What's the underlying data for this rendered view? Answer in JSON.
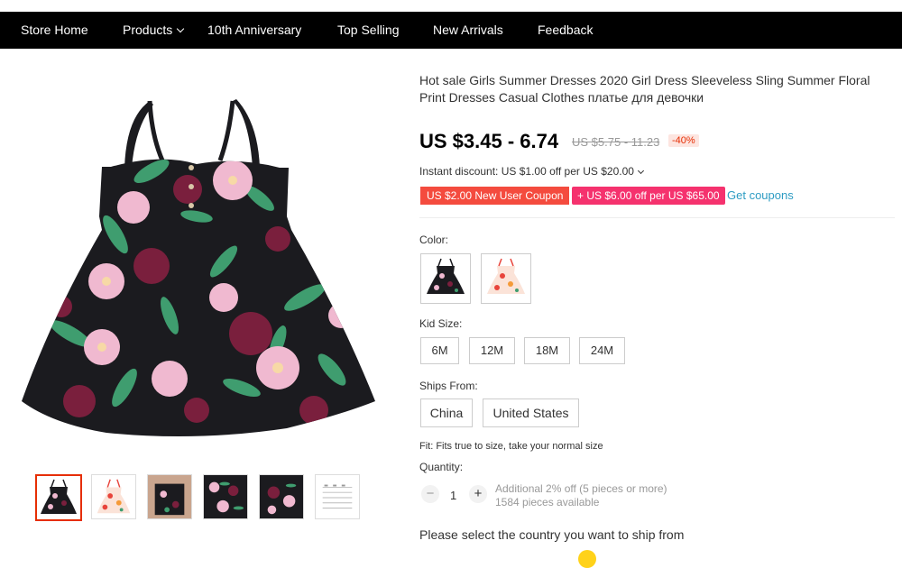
{
  "nav": {
    "items": [
      "Store Home",
      "Products",
      "10th Anniversary",
      "Top Selling",
      "New Arrivals",
      "Feedback"
    ]
  },
  "product": {
    "title": "Hot sale Girls Summer Dresses 2020 Girl Dress Sleeveless Sling Summer Floral Print Dresses Casual Clothes платье для девочки",
    "price": "US $3.45 - 6.74",
    "original_price": "US $5.75 - 11.23",
    "discount": "-40%",
    "instant_discount": "Instant discount: US $1.00 off per US $20.00",
    "coupon_new_user": "US $2.00 New User Coupon",
    "coupon_store": "+ US $6.00 off per US $65.00",
    "get_coupons": "Get coupons"
  },
  "options": {
    "color_label": "Color:",
    "size_label": "Kid Size:",
    "sizes": [
      "6M",
      "12M",
      "18M",
      "24M"
    ],
    "ships_label": "Ships From:",
    "ships_from": [
      "China",
      "United States"
    ]
  },
  "fit_note": "Fit: Fits true to size, take your normal size",
  "quantity": {
    "label": "Quantity:",
    "value": "1",
    "minus": "−",
    "plus": "+",
    "bulk_offer": "Additional 2% off (5 pieces or more)",
    "available": "1584 pieces available"
  },
  "ship_message": "Please select the country you want to ship from",
  "colors": {
    "dress_dark": "#1b1b1f",
    "flower_pink": "#f0b9d0",
    "flower_burgundy": "#7a1f3d",
    "leaf_green": "#3f9d6f",
    "dress_light": "#fbe3d8",
    "flower_red": "#e8443b",
    "flower_orange": "#f59a38",
    "accent_red": "#e62e04",
    "coupon_red": "#f44b3e",
    "coupon_pink": "#f5326e",
    "link_blue": "#2e9cc3"
  },
  "icons": {
    "products_dropdown": "chevron-down-icon",
    "instant_dropdown": "chevron-down-icon",
    "qty_minus": "minus-icon",
    "qty_plus": "plus-icon"
  }
}
